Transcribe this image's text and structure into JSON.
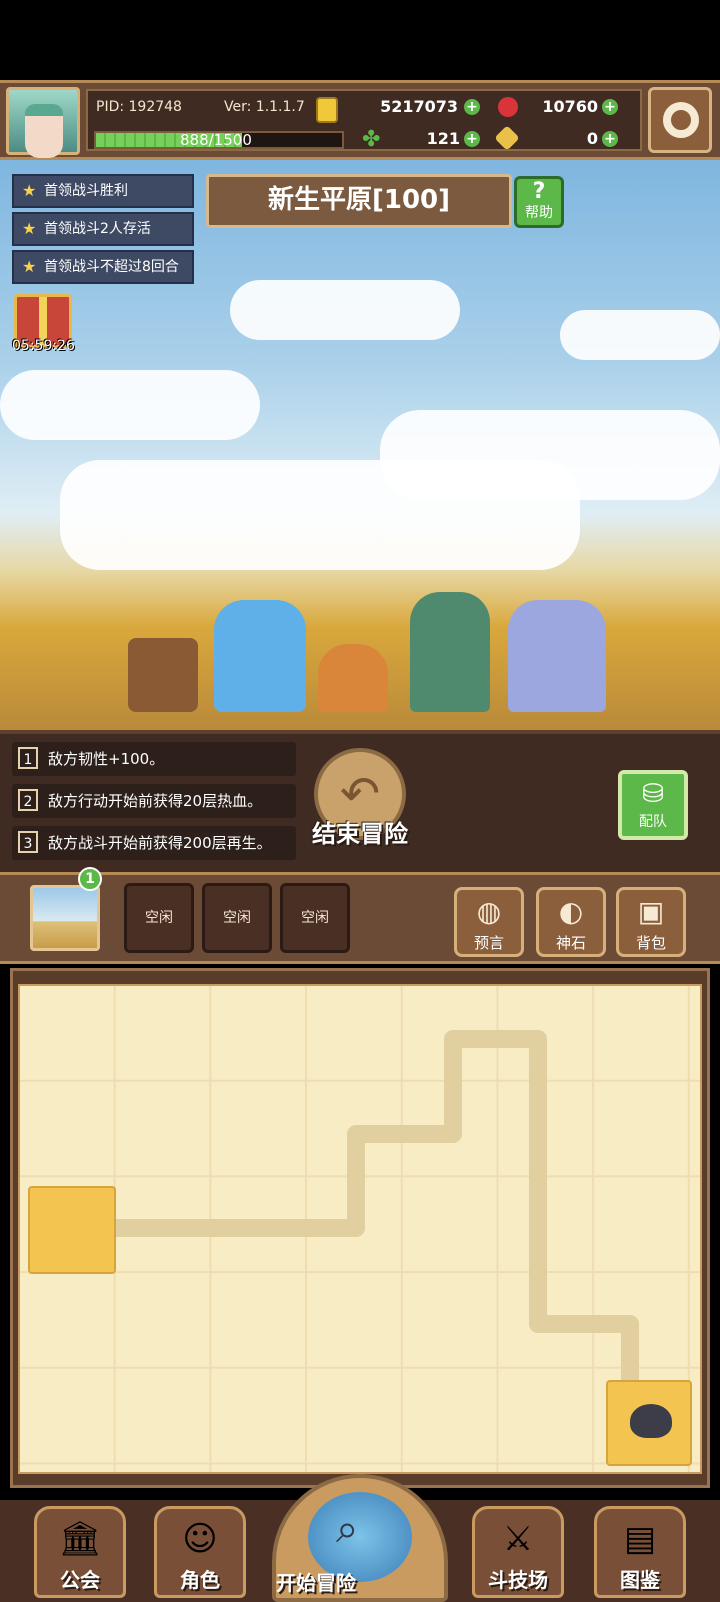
{
  "hud": {
    "pid": "PID: 192748",
    "version": "Ver: 1.1.1.7",
    "gold": "5217073",
    "gems": "10760",
    "xp_text": "888/1500",
    "xp_fraction": 0.592,
    "clover": "121",
    "key": "0"
  },
  "quests": [
    "首领战斗胜利",
    "首领战斗2人存活",
    "首领战斗不超过8回合"
  ],
  "stage": {
    "title": "新生平原[100]",
    "help_label": "帮助"
  },
  "gift": {
    "timer": "05:59:26"
  },
  "rules": [
    {
      "num": "1",
      "text": "敌方韧性+100。"
    },
    {
      "num": "2",
      "text": "敌方行动开始前获得20层热血。"
    },
    {
      "num": "3",
      "text": "敌方战斗开始前获得200层再生。"
    }
  ],
  "actions": {
    "end_adventure": "结束冒险",
    "team": "配队"
  },
  "toolbar": {
    "badge": "1",
    "slots": [
      "空闲",
      "空闲",
      "空闲"
    ],
    "prophecy": "预言",
    "god_stone": "神石",
    "backpack": "背包"
  },
  "nav": {
    "guild": "公会",
    "character": "角色",
    "start": "开始冒险",
    "arena": "斗技场",
    "codex": "图鉴"
  },
  "colors": {
    "accent_green": "#5cb848",
    "panel_brown": "#6b4a36",
    "board": "#f8ecc5"
  }
}
